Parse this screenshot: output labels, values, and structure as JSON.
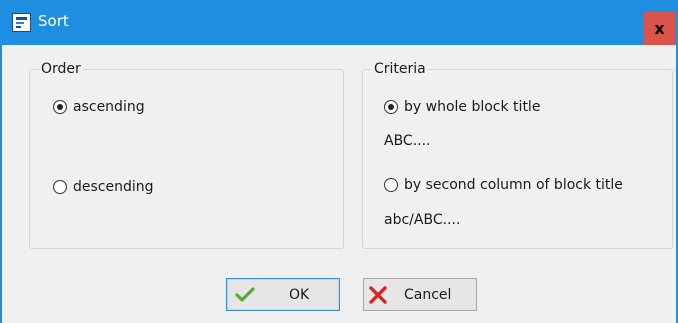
{
  "window": {
    "title": "Sort",
    "close_label": "x",
    "accent": "#1f8ee0",
    "close_color": "#d9544a"
  },
  "order_group": {
    "legend": "Order",
    "options": [
      {
        "label": "ascending",
        "checked": true
      },
      {
        "label": "descending",
        "checked": false
      }
    ]
  },
  "criteria_group": {
    "legend": "Criteria",
    "options": [
      {
        "label": "by whole block title",
        "example": "ABC....",
        "checked": true
      },
      {
        "label": "by second column of block title",
        "example": "abc/ABC....",
        "checked": false
      }
    ]
  },
  "buttons": {
    "ok_label": "OK",
    "ok_icon": "checkmark-icon",
    "cancel_label": "Cancel",
    "cancel_icon": "cross-icon"
  }
}
